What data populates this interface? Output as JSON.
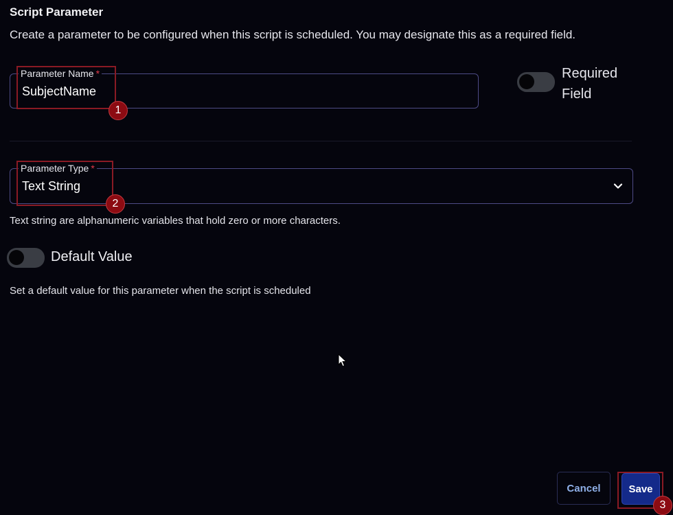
{
  "header": {
    "title": "Script Parameter",
    "description": "Create a parameter to be configured when this script is scheduled. You may designate this as a required field."
  },
  "parameter_name": {
    "label": "Parameter Name",
    "required_marker": "*",
    "value": "SubjectName"
  },
  "required_field": {
    "label_line1": "Required",
    "label_line2": "Field",
    "enabled": false
  },
  "parameter_type": {
    "label": "Parameter Type",
    "required_marker": "*",
    "selected": "Text String",
    "hint": "Text string are alphanumeric variables that hold zero or more characters."
  },
  "default_value": {
    "label": "Default Value",
    "enabled": false,
    "hint": "Set a default value for this parameter when the script is scheduled"
  },
  "footer": {
    "cancel_label": "Cancel",
    "save_label": "Save"
  },
  "annotations": {
    "step1": "1",
    "step2": "2",
    "step3": "3",
    "highlight_color": "#8a1a24"
  },
  "colors": {
    "background": "#05050d",
    "field_border": "#4e4b86",
    "save_button": "#142a8a",
    "cancel_text": "#8fb0e8",
    "required_star": "#e0394a"
  }
}
